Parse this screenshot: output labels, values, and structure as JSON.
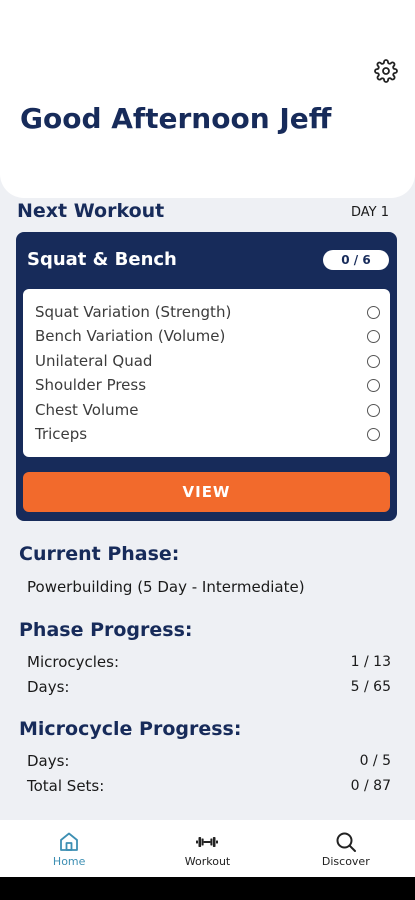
{
  "header": {
    "greeting": "Good Afternoon Jeff",
    "settings_icon": "gear-icon"
  },
  "next_workout": {
    "title": "Next Workout",
    "day": "DAY 1",
    "card": {
      "name": "Squat & Bench",
      "progress": "0 / 6",
      "exercises": [
        {
          "label": "Squat Variation (Strength)",
          "completed": false
        },
        {
          "label": "Bench Variation (Volume)",
          "completed": false
        },
        {
          "label": "Unilateral Quad",
          "completed": false
        },
        {
          "label": "Shoulder Press",
          "completed": false
        },
        {
          "label": "Chest Volume",
          "completed": false
        },
        {
          "label": "Triceps",
          "completed": false
        }
      ],
      "view_label": "VIEW"
    }
  },
  "current_phase": {
    "title": "Current Phase:",
    "value": "Powerbuilding (5 Day - Intermediate)"
  },
  "phase_progress": {
    "title": "Phase Progress:",
    "rows": [
      {
        "label": "Microcycles:",
        "value": "1 / 13"
      },
      {
        "label": "Days:",
        "value": "5 / 65"
      }
    ]
  },
  "microcycle_progress": {
    "title": "Microcycle Progress:",
    "rows": [
      {
        "label": "Days:",
        "value": "0 / 5"
      },
      {
        "label": "Total Sets:",
        "value": "0 / 87"
      }
    ]
  },
  "bottom_nav": {
    "items": [
      {
        "label": "Home",
        "icon": "home-icon",
        "active": true
      },
      {
        "label": "Workout",
        "icon": "dumbbell-icon",
        "active": false
      },
      {
        "label": "Discover",
        "icon": "search-icon",
        "active": false
      }
    ]
  },
  "colors": {
    "navy": "#172b5a",
    "accent_orange": "#f26a2c",
    "active_nav": "#3d8fb3",
    "background": "#eef0f4"
  }
}
